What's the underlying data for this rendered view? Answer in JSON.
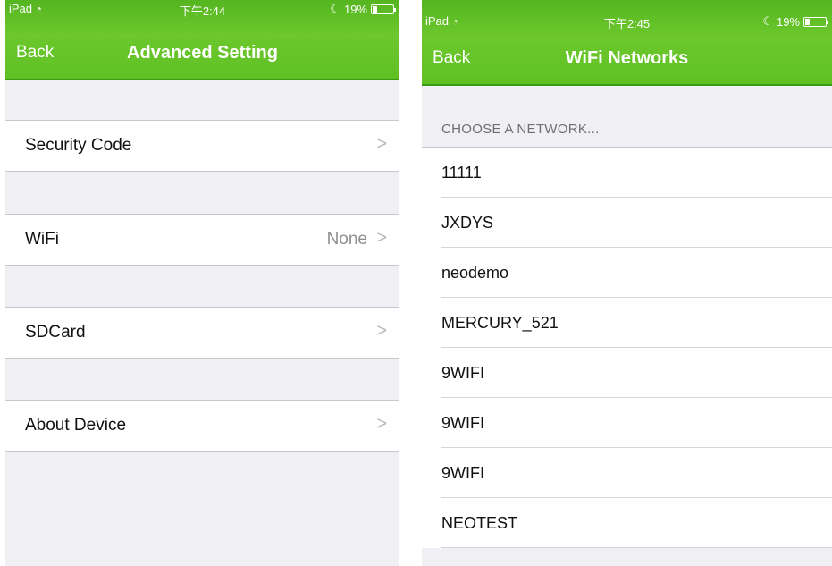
{
  "left": {
    "status": {
      "carrier": "iPad",
      "time": "下午2:44",
      "battery": "19%"
    },
    "nav": {
      "back": "Back",
      "title": "Advanced Setting"
    },
    "rows": [
      {
        "label": "Security Code",
        "value": "",
        "chevron": ">"
      },
      {
        "label": "WiFi",
        "value": "None",
        "chevron": ">"
      },
      {
        "label": "SDCard",
        "value": "",
        "chevron": ">"
      },
      {
        "label": "About Device",
        "value": "",
        "chevron": ">"
      }
    ]
  },
  "right": {
    "status": {
      "carrier": "iPad",
      "time": "下午2:45",
      "battery": "19%"
    },
    "nav": {
      "back": "Back",
      "title": "WiFi Networks"
    },
    "section_header": "CHOOSE A NETWORK...",
    "networks": [
      "11111",
      "JXDYS",
      "neodemo",
      "MERCURY_521",
      "9WIFI",
      "9WIFI",
      "9WIFI",
      "NEOTEST"
    ]
  },
  "colors": {
    "nav_green": "#6cc82c",
    "background": "#efeff4"
  }
}
